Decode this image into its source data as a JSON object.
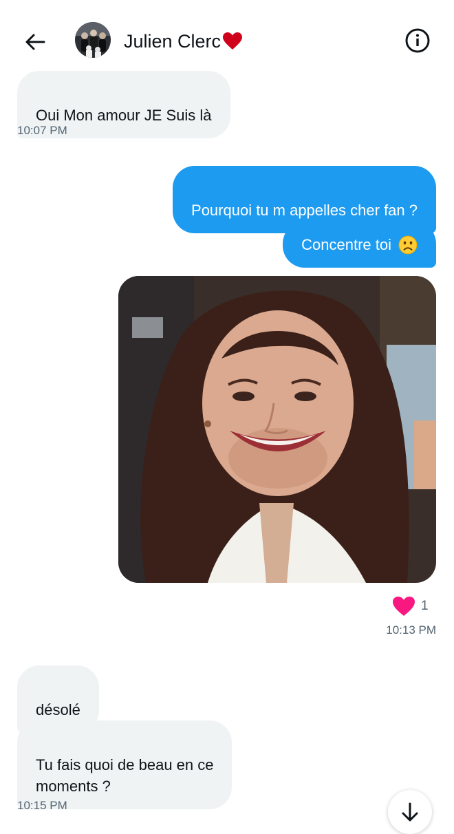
{
  "header": {
    "contact_name": "Julien Clerc",
    "icons": {
      "back": "arrow-left-icon",
      "info": "info-circle-icon",
      "heart_emoji": "red-heart-emoji"
    },
    "heart_color": "#d0021b"
  },
  "messages": [
    {
      "direction": "in",
      "text": "Oui Mon amour JE Suis là"
    },
    {
      "time": "10:07 PM"
    },
    {
      "direction": "out",
      "text": "Pourquoi tu m appelles cher fan ?"
    },
    {
      "direction": "out",
      "text": "Concentre toi",
      "emoji": "frowning-face-emoji"
    },
    {
      "direction": "out",
      "type": "photo",
      "reaction": {
        "icon": "heart-icon",
        "count": "1"
      }
    },
    {
      "time": "10:13 PM"
    },
    {
      "direction": "in",
      "text": "désolé"
    },
    {
      "direction": "in",
      "text": "Tu fais quoi de beau en ce\nmoments ?"
    },
    {
      "time": "10:15 PM"
    }
  ],
  "scroll_button": {
    "icon": "arrow-down-icon"
  },
  "colors": {
    "accent": "#1d9bf0",
    "incoming_bubble": "#eff3f4",
    "timestamp": "#536471",
    "reaction_heart": "#f91880"
  }
}
